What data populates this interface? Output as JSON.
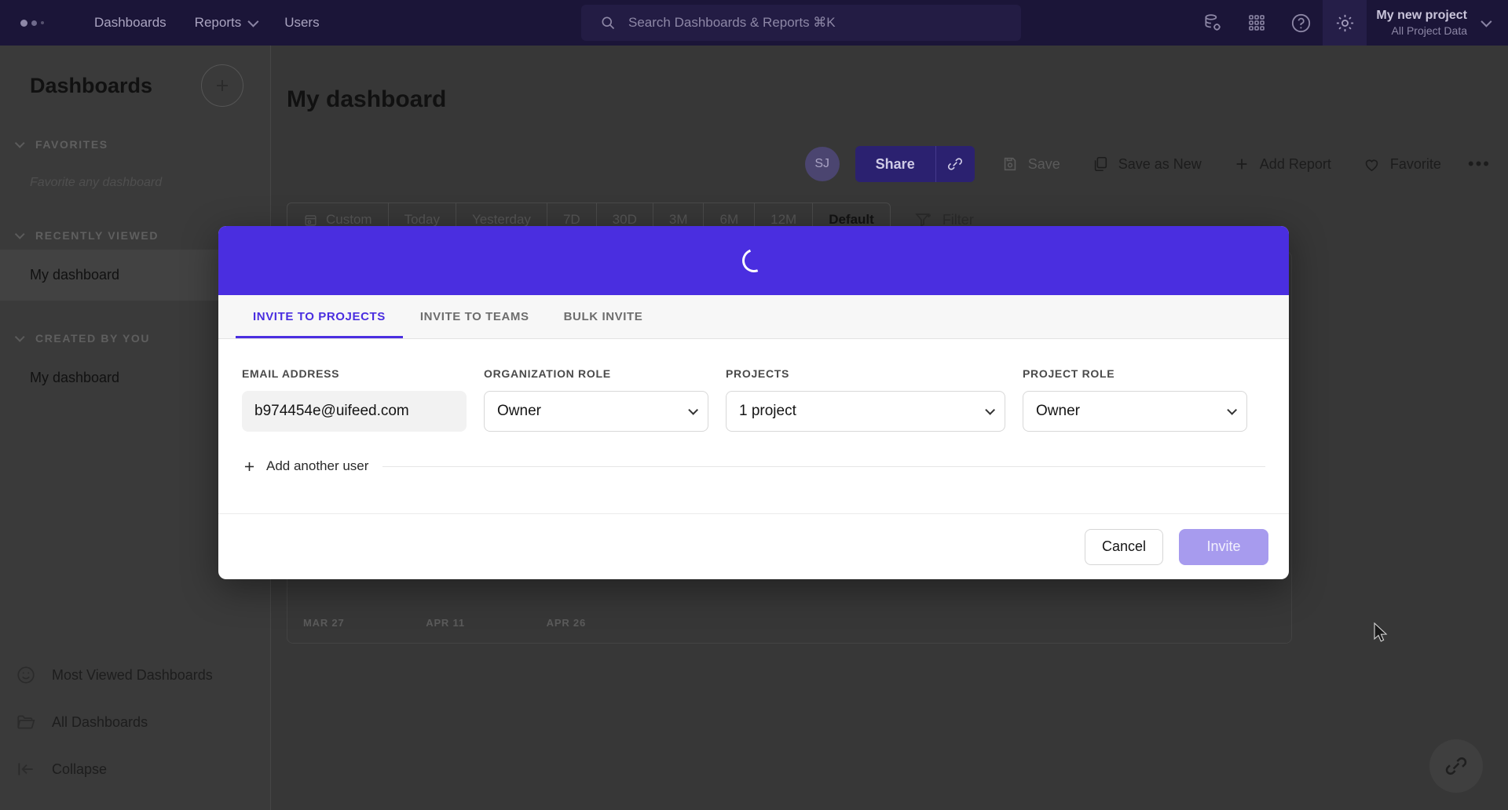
{
  "topnav": {
    "logo": "logo-dots",
    "links": [
      {
        "label": "Dashboards",
        "has_caret": false
      },
      {
        "label": "Reports",
        "has_caret": true
      },
      {
        "label": "Users",
        "has_caret": false
      }
    ],
    "search_placeholder": "Search Dashboards & Reports ⌘K",
    "icons": [
      "database-gear-icon",
      "apps-grid-icon",
      "help-circle-icon",
      "settings-gear-icon"
    ],
    "project_name": "My new project",
    "project_sub": "All Project Data"
  },
  "sidebar": {
    "title": "Dashboards",
    "add_label": "+",
    "groups": [
      {
        "label": "FAVORITES",
        "empty_text": "Favorite any dashboard",
        "items": []
      },
      {
        "label": "RECENTLY VIEWED",
        "items": [
          {
            "label": "My dashboard"
          }
        ]
      },
      {
        "label": "CREATED BY YOU",
        "items": [
          {
            "label": "My dashboard"
          }
        ]
      }
    ],
    "bottom_items": [
      {
        "label": "Most Viewed Dashboards",
        "icon": "smiley-icon"
      },
      {
        "label": "All Dashboards",
        "icon": "folder-icon"
      },
      {
        "label": "Collapse",
        "icon": "collapse-arrow-icon"
      }
    ]
  },
  "main": {
    "dashboard_title": "My dashboard",
    "avatar_initials": "SJ",
    "toolbar": {
      "share_label": "Share",
      "link_icon": "link-icon",
      "save_label": "Save",
      "save_as_new_label": "Save as New",
      "add_report_label": "Add Report",
      "favorite_label": "Favorite",
      "more_label": "•••"
    },
    "date_range": {
      "items": [
        "Custom",
        "Today",
        "Yesterday",
        "7D",
        "30D",
        "3M",
        "6M",
        "12M",
        "Default"
      ],
      "active": "Default",
      "filter_label": "Filter"
    },
    "fab_icon": "link-icon"
  },
  "chart_data": {
    "type": "line",
    "title": "",
    "xlabel": "",
    "ylabel": "",
    "x_tick_labels": [
      "MAR 27",
      "APR 11",
      "APR 26"
    ],
    "series": [],
    "grid": false,
    "legend": "none"
  },
  "modal": {
    "header_color": "#4a2ee0",
    "spinner": "loading-spinner",
    "tabs": [
      {
        "label": "INVITE TO PROJECTS",
        "active": true
      },
      {
        "label": "INVITE TO TEAMS",
        "active": false
      },
      {
        "label": "BULK INVITE",
        "active": false
      }
    ],
    "fields": {
      "email_label": "EMAIL ADDRESS",
      "email_value": "b974454e@uifeed.com",
      "org_role_label": "ORGANIZATION ROLE",
      "org_role_value": "Owner",
      "projects_label": "PROJECTS",
      "projects_value": "1 project",
      "project_role_label": "PROJECT ROLE",
      "project_role_value": "Owner"
    },
    "add_another_label": "Add another user",
    "cancel_label": "Cancel",
    "invite_label": "Invite"
  }
}
